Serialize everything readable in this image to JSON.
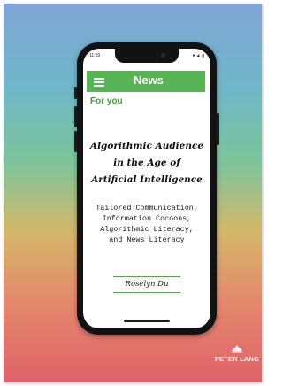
{
  "phone": {
    "status_time": "11:19",
    "status_icons": "● ▲ ▮"
  },
  "app_bar": {
    "title": "News",
    "menu_icon": "hamburger-menu-icon"
  },
  "section_label": "For you",
  "book": {
    "title_lines": [
      "Algorithmic Audience",
      "in the Age of",
      "Artificial Intelligence"
    ],
    "subtitle_lines": [
      "Tailored Communication,",
      "Information Cocoons,",
      "Algorithmic Literacy,",
      "and News Literacy"
    ],
    "author": "Roselyn Du"
  },
  "publisher": {
    "name": "PETER LANG",
    "logo_icon": "peter-lang-logo-icon"
  },
  "colors": {
    "accent_green": "#59b455",
    "gradient_top": "#7fa6d6",
    "gradient_bottom": "#e0626a"
  }
}
